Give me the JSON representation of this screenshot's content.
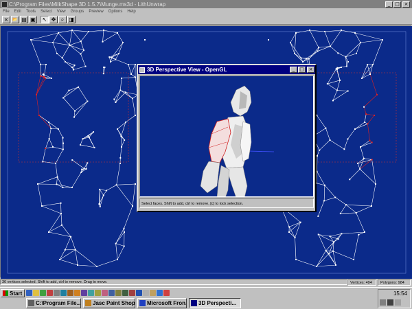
{
  "window": {
    "title": "C:\\Program Files\\MilkShape 3D 1.5.7\\Munge.ms3d - LithUnwrap",
    "btn_min": "_",
    "btn_max": "□",
    "btn_close": "×"
  },
  "menu": [
    "File",
    "Edit",
    "Tools",
    "Select",
    "View",
    "Groups",
    "Preview",
    "Options",
    "Help"
  ],
  "toolbar": {
    "buttons": [
      {
        "name": "close-model-button",
        "icon": "×"
      },
      {
        "name": "open-button",
        "icon": "📂"
      },
      {
        "name": "open-image-button",
        "icon": "▤"
      },
      {
        "name": "save-button",
        "icon": "▣"
      },
      {
        "name": "select-arrow-button",
        "icon": "↖"
      },
      {
        "name": "move-button",
        "icon": "✥"
      },
      {
        "name": "zoom-button",
        "icon": "⌕"
      },
      {
        "name": "zoom-extents-button",
        "icon": "◨"
      }
    ]
  },
  "perspective": {
    "title": "3D Perspective View - OpenGL",
    "status": "Select faces.  Shift to add, ctrl to remove, [c] to lock selection."
  },
  "status": {
    "message": "36 vertices selected.  Shift to add, ctrl to remove.  Drag to move.",
    "vertices": "Vertices: 494",
    "polygons": "Polygons: 984"
  },
  "taskbar": {
    "start": "Start",
    "tasks": [
      {
        "label": "C:\\Program File...",
        "icon_color": "#606060",
        "active": false
      },
      {
        "label": "Jasc Paint Shop...",
        "icon_color": "#c08020",
        "active": false
      },
      {
        "label": "Microsoft Fron...",
        "icon_color": "#2040c0",
        "active": false
      },
      {
        "label": "3D Perspecti...",
        "icon_color": "#000080",
        "active": true
      }
    ],
    "clock": "15:54"
  },
  "colors": {
    "viewport_bg": "#0b2a8a",
    "wire": "#ffffff",
    "selected": "#e02020"
  }
}
